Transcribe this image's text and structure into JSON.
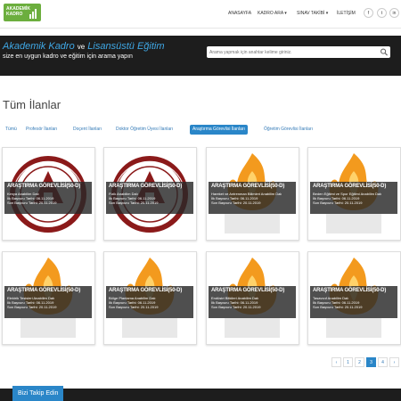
{
  "header": {
    "logo_text_1": "AKADEMİK",
    "logo_text_2": "KADRO",
    "nav": [
      "ANASAYFA",
      "KADRO ARA ▾",
      "SINAV TAKİBİ ▾",
      "İLETİŞİM"
    ],
    "social_icons": [
      "facebook-icon",
      "twitter-icon",
      "linkedin-icon"
    ],
    "social_glyphs": [
      "f",
      "t",
      "in"
    ]
  },
  "hero": {
    "title_part1": "Akademik Kadro",
    "title_ve": "ve",
    "title_part2": "Lisansüstü Eğitim",
    "subtitle": "size en uygun kadro ve eğitim için arama yapın",
    "search_placeholder": "Arama yapmak için anahtar kelime giriniz."
  },
  "page_title": "Tüm İlanlar",
  "tabs": [
    "Tümü",
    "Profesör İlanları",
    "Doçent İlanları",
    "Doktor Öğretim Üyesi İlanları",
    "Araştırma Görevlisi İlanları",
    "Öğretim Görevlisi İlanları"
  ],
  "active_tab": 4,
  "cards": [
    {
      "title": "ARAŞTIRMA GÖREVLİSİ(50-D)",
      "dept": "Kimya Anabilim Dalı",
      "start": "İlk Başvuru Tarihi: 06.11.2019",
      "end": "Son Başvuru Tarihi: 20.11.2019",
      "logo": "technical-university-seal"
    },
    {
      "title": "ARAŞTIRMA GÖREVLİSİ(50-D)",
      "dept": "Fizik Anabilim Dalı",
      "start": "İlk Başvuru Tarihi: 06.11.2019",
      "end": "Son Başvuru Tarihi: 20.11.2019",
      "logo": "technical-university-seal"
    },
    {
      "title": "ARAŞTIRMA GÖREVLİSİ(50-D)",
      "dept": "Hareket ve Antrenman Bilimleri Anabilim Dalı",
      "start": "İlk Başvuru Tarihi: 06.11.2019",
      "end": "Son Başvuru Tarihi: 20.11.2019",
      "logo": "flame-logo"
    },
    {
      "title": "ARAŞTIRMA GÖREVLİSİ(50-D)",
      "dept": "Beden Eğitimi ve Spor Eğitimi Anabilim Dalı",
      "start": "İlk Başvuru Tarihi: 06.11.2019",
      "end": "Son Başvuru Tarihi: 20.11.2019",
      "logo": "flame-logo"
    },
    {
      "title": "ARAŞTIRMA GÖREVLİSİ(50-D)",
      "dept": "Elektrik Tesisleri Anabilim Dalı",
      "start": "İlk Başvuru Tarihi: 06.11.2019",
      "end": "Son Başvuru Tarihi: 20.11.2019",
      "logo": "flame-logo"
    },
    {
      "title": "ARAŞTIRMA GÖREVLİSİ(50-D)",
      "dept": "Bölge Planlama Anabilim Dalı",
      "start": "İlk Başvuru Tarihi: 06.11.2019",
      "end": "Son Başvuru Tarihi: 20.11.2019",
      "logo": "flame-logo"
    },
    {
      "title": "ARAŞTIRMA GÖREVLİSİ(50-D)",
      "dept": "Endüstri Bitkileri Anabilim Dalı",
      "start": "İlk Başvuru Tarihi: 06.11.2019",
      "end": "Son Başvuru Tarihi: 20.11.2019",
      "logo": "flame-logo"
    },
    {
      "title": "ARAŞTIRMA GÖREVLİSİ(50-D)",
      "dept": "Tasavvuf Anabilim Dalı",
      "start": "İlk Başvuru Tarihi: 06.11.2019",
      "end": "Son Başvuru Tarihi: 20.11.2019",
      "logo": "flame-logo"
    }
  ],
  "pagination": [
    "‹",
    "1",
    "2",
    "3",
    "4",
    "›"
  ],
  "current_page": "3",
  "footer": {
    "follow_label": "Bizi Takip Edin"
  },
  "colors": {
    "accent": "#2a86c8",
    "brand_green": "#6cae3e",
    "hero_bg": "#1d1d1d",
    "title_blue": "#3fa8e6",
    "seal_red": "#8b1a1a",
    "flame_orange": "#f39a1e"
  }
}
